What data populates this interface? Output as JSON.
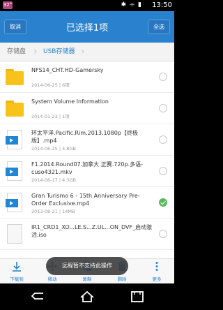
{
  "status_bar": {
    "badge": "32°",
    "icons": "✱ ⌯ ▮",
    "time": "13:50"
  },
  "app_bar": {
    "cancel_label": "取消",
    "title": "已选择1项",
    "select_all_label": "全选"
  },
  "breadcrumb": {
    "items": [
      "存储盘",
      "USB存储器"
    ]
  },
  "files": [
    {
      "name": "NFS14_CHT.HD-Gamersky",
      "meta": "2014-06-25 | 6项",
      "type": "folder",
      "selected": false
    },
    {
      "name": "System Volume Information",
      "meta": "2014-01-23 | 1项",
      "type": "folder",
      "selected": false
    },
    {
      "name": "环太平洋.Pacific.Rim.2013.1080p【终极版】.mp4",
      "meta": "2014-06-25 | 4.8GB",
      "type": "video",
      "selected": false
    },
    {
      "name": "F1.2014.Round07.加拿大.正赛.720p.多语-cuso4321.mkv",
      "meta": "2014-06-17 | 4.3GB",
      "type": "video",
      "selected": false
    },
    {
      "name": "Gran Turismo 6 - 15th Anniversary Pre-Order Exclusive.mp4",
      "meta": "2013-08-21 | 14MB",
      "type": "video",
      "selected": true
    },
    {
      "name": "IR1_CRD1_XO...LE.S...Z.UL...ON_DVF_启动激活.iso",
      "meta": "",
      "type": "document",
      "selected": false
    }
  ],
  "toast": "远程暂不支持此操作",
  "toolbar": {
    "items": [
      "下载到",
      "移动",
      "复制",
      "删除",
      "更多"
    ]
  },
  "colors": {
    "accent": "#2a82cf",
    "folder": "#f7c21a",
    "selected": "#5cb85c"
  }
}
